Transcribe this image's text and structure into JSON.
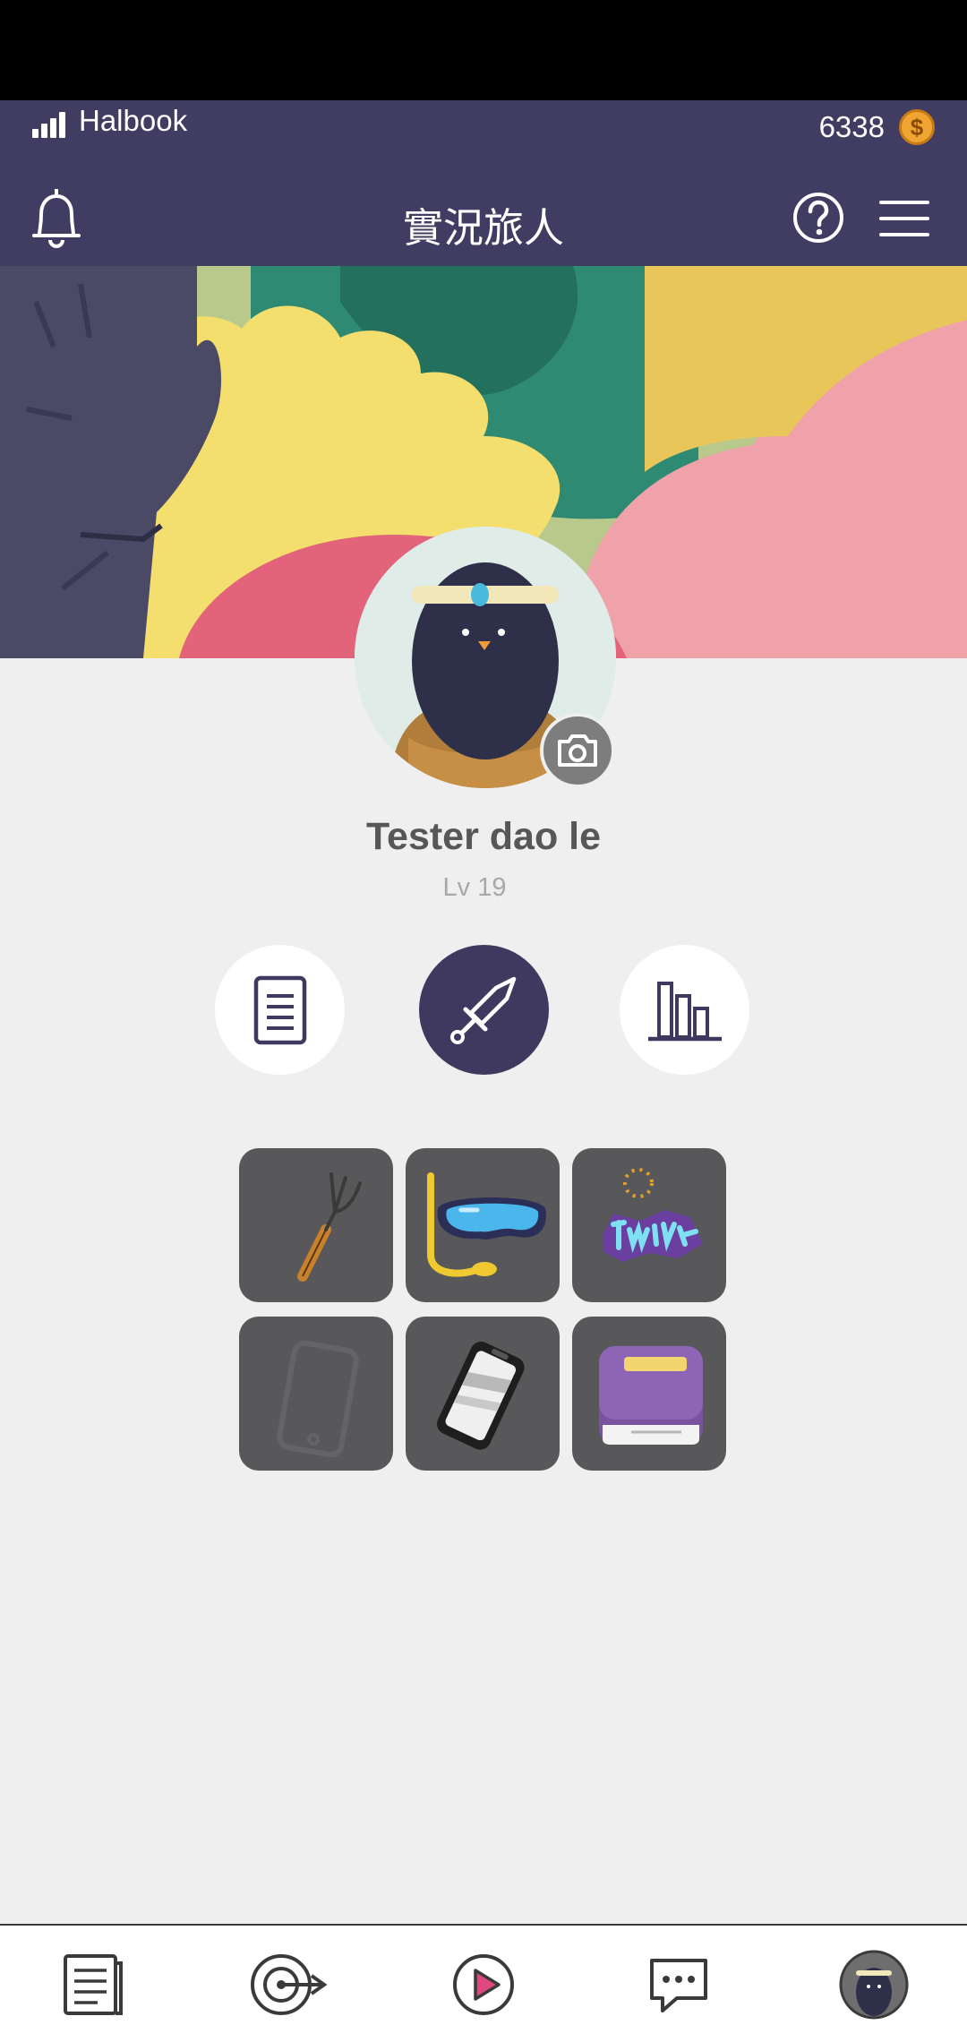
{
  "status": {
    "carrier": "Halbook",
    "coins": "6338",
    "coin_symbol": "$"
  },
  "header": {
    "title": "實況旅人"
  },
  "profile": {
    "name": "Tester dao le",
    "level": "Lv 19"
  },
  "tabs": [
    {
      "name": "list",
      "icon": "document-icon",
      "active": false
    },
    {
      "name": "equipment",
      "icon": "sword-icon",
      "active": true
    },
    {
      "name": "stats",
      "icon": "bar-chart-icon",
      "active": false
    }
  ],
  "items": [
    {
      "name": "pitchfork",
      "icon": "pitchfork-icon",
      "locked": false
    },
    {
      "name": "snorkel-goggles",
      "icon": "goggles-icon",
      "locked": false
    },
    {
      "name": "graffiti-tag",
      "icon": "graffiti-icon",
      "locked": false
    },
    {
      "name": "phone-placeholder",
      "icon": "phone-icon",
      "locked": true
    },
    {
      "name": "screen-protector",
      "icon": "phone-case-icon",
      "locked": false
    },
    {
      "name": "book",
      "icon": "book-icon",
      "locked": false
    }
  ],
  "bottom_nav": [
    {
      "name": "journal",
      "icon": "journal-icon"
    },
    {
      "name": "target",
      "icon": "target-icon"
    },
    {
      "name": "play",
      "icon": "play-icon"
    },
    {
      "name": "chat",
      "icon": "chat-icon"
    },
    {
      "name": "profile",
      "icon": "avatar-icon"
    }
  ],
  "colors": {
    "header_bg": "#413c62",
    "accent": "#3f3960",
    "page_bg": "#efefef",
    "coin": "#f0a431",
    "play_pink": "#e0467f"
  }
}
